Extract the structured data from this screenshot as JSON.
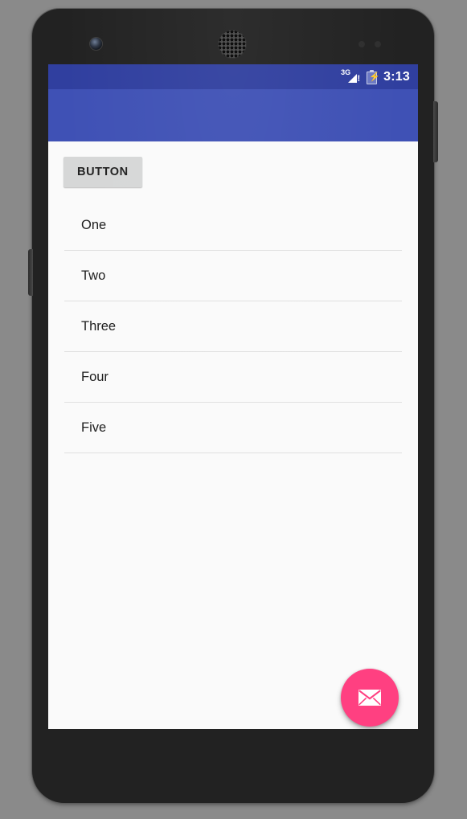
{
  "device": {
    "name": "android-phone-mockup",
    "hardware": {
      "front_camera": "camera-icon",
      "earpiece": "speaker-grille-icon",
      "proximity_sensor": "sensor-icon",
      "light_sensor": "sensor-icon",
      "power_button": "power-button",
      "volume_button": "volume-rocker"
    }
  },
  "colors": {
    "status_bar": "#303F9F",
    "app_bar": "#3F51B5",
    "fab": "#FF4081",
    "content_background": "#FAFAFA",
    "button_background": "#D6D7D7",
    "divider": "#E0E0E0",
    "nav_bar": "#000000"
  },
  "status_bar": {
    "signal_label": "3G",
    "signal_alert": "!",
    "signal_icon": "signal-cellular-3g-icon",
    "battery_icon": "battery-charging-icon",
    "battery_bolt": "⚡",
    "time": "3:13"
  },
  "app_bar": {
    "title": ""
  },
  "content": {
    "button": {
      "label": "BUTTON"
    },
    "list": {
      "items": [
        {
          "label": "One"
        },
        {
          "label": "Two"
        },
        {
          "label": "Three"
        },
        {
          "label": "Four"
        },
        {
          "label": "Five"
        }
      ]
    },
    "fab": {
      "icon": "mail-envelope-icon",
      "label": ""
    }
  },
  "nav_bar": {
    "keys": [
      {
        "name": "back",
        "icon": "back-triangle-icon"
      },
      {
        "name": "home",
        "icon": "home-circle-icon"
      },
      {
        "name": "recents",
        "icon": "recents-square-icon"
      }
    ]
  }
}
